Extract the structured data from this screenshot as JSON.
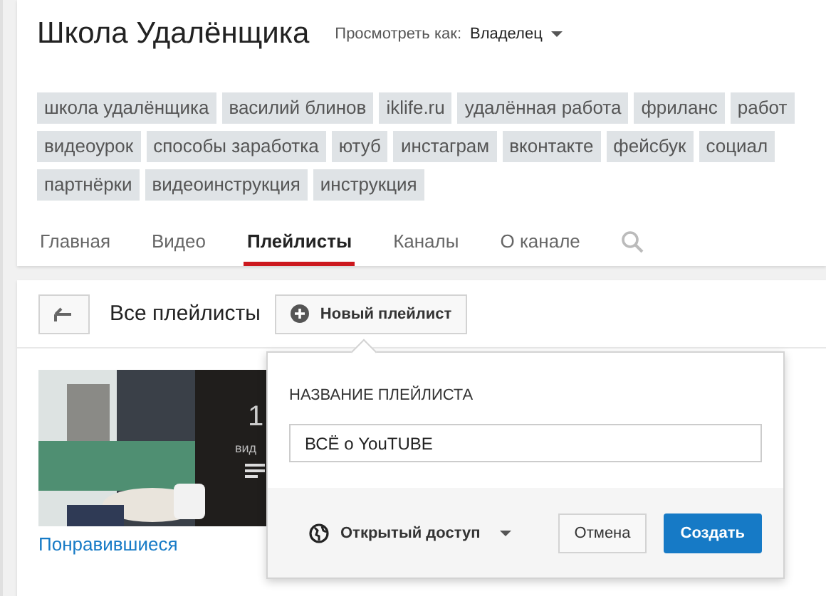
{
  "channel": {
    "title": "Школа Удалёнщика",
    "view_as_label": "Просмотреть как:",
    "view_as_value": "Владелец"
  },
  "tags": [
    [
      "школа удалёнщика",
      "василий блинов",
      "iklife.ru",
      "удалённая работа",
      "фриланс",
      "работ"
    ],
    [
      "видеоурок",
      "способы заработка",
      "ютуб",
      "инстаграм",
      "вконтакте",
      "фейсбук",
      "социал"
    ],
    [
      "партнёрки",
      "видеоинструкция",
      "инструкция"
    ]
  ],
  "tabs": [
    {
      "label": "Главная",
      "selected": false
    },
    {
      "label": "Видео",
      "selected": false
    },
    {
      "label": "Плейлисты",
      "selected": true
    },
    {
      "label": "Каналы",
      "selected": false
    },
    {
      "label": "О канале",
      "selected": false
    }
  ],
  "toolbar": {
    "heading": "Все плейлисты",
    "new_button": "Новый плейлист"
  },
  "playlist": {
    "count": "1",
    "count_label": "вид",
    "title": "Понравившиеся"
  },
  "popup": {
    "field_label": "НАЗВАНИЕ ПЛЕЙЛИСТА",
    "value": "ВСЁ о YouTUBE",
    "privacy": "Открытый доступ",
    "cancel": "Отмена",
    "create": "Создать"
  }
}
